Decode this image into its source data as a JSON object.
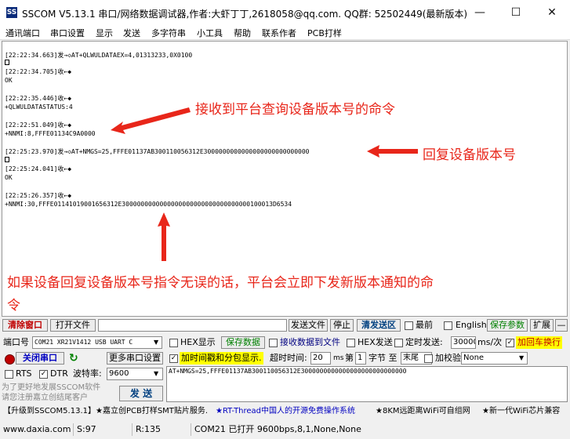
{
  "window": {
    "title": "SSCOM V5.13.1 串口/网络数据调试器,作者:大虾丁丁,2618058@qq.com. QQ群: 52502449(最新版本)",
    "app_icon": "SS",
    "minimize": "—",
    "maximize": "☐",
    "close": "✕"
  },
  "menu": [
    "通讯端口",
    "串口设置",
    "显示",
    "发送",
    "多字符串",
    "小工具",
    "帮助",
    "联系作者",
    "PCB打样"
  ],
  "receive_log": [
    "[22:22:34.663]发→◇AT+QLWULDATAEX=4,01313233,0X0100",
    "[22:22:34.705]收←◆",
    "OK",
    "[22:22:35.446]收←◆",
    "+QLWULDATASTATUS:4",
    "[22:22:51.049]收←◆",
    "+NNMI:8,FFFE01134C9A0000",
    "[22:25:23.970]发→◇AT+NMGS=25,FFFE01137AB300110056312E3000000000000000000000000000",
    "[22:25:24.041]收←◆",
    "OK",
    "[22:25:26.357]收←◆",
    "+NNMI:30,FFFE01141019001656312E3000000000000000000000000000000000100013D6534"
  ],
  "annotations": {
    "a1": "接收到平台查询设备版本号的命令",
    "a2": "回复设备版本号",
    "a3_line1": "如果设备回复设备版本号指令无误的话，平台会立即下发新版本通知的命",
    "a3_line2": "令"
  },
  "toolbar1": {
    "clear_window": "清除窗口",
    "open_file": "打开文件",
    "send_file": "发送文件",
    "stop": "停止",
    "clear_send": "清发送区",
    "topmost": "最前",
    "english": "English",
    "save_params": "保存参数",
    "expand": "扩展",
    "minus": "—"
  },
  "row2": {
    "port_label": "端口号",
    "port_value": "COM21 XR21V1412 USB UART C",
    "hex_display": "HEX显示",
    "save_data": "保存数据",
    "recv_to_file": "接收数据到文件",
    "hex_send": "HEX发送",
    "timed_send": "定时发送:",
    "interval": "30000",
    "interval_unit": "ms/次",
    "add_crlf": "加回车换行"
  },
  "row3": {
    "close_port": "关闭串口",
    "more_settings": "更多串口设置",
    "timestamp": "加时间戳和分包显示.",
    "timeout_label": "超时时间:",
    "timeout": "20",
    "ms": "ms",
    "page_label": "第",
    "page": "1",
    "byte_label": "字节 至",
    "to_value": "末尾",
    "checksum_label": "加校验",
    "checksum_value": "None"
  },
  "row4": {
    "rts": "RTS",
    "dtr": "DTR",
    "baud_label": "波特率:",
    "baud": "9600"
  },
  "send_text": "AT+NMGS=25,FFFE01137AB300110056312E3000000000000000000000000000",
  "send_button": "发 送",
  "register_text_1": "为了更好地发展SSCOM软件",
  "register_text_2": "请您注册嘉立创结尾客户",
  "promo": [
    "【升级到SSCOM5.13.1】★嘉立创PCB打样SMT贴片服务.",
    "★RT-Thread中国人的开源免费操作系统",
    "★8KM远距离WiFi可自组网",
    "★新一代WiFi芯片兼容"
  ],
  "statusbar": {
    "url": "www.daxia.com",
    "sent": "S:97",
    "received": "R:135",
    "port_status": "COM21 已打开  9600bps,8,1,None,None"
  },
  "colors": {
    "annotation": "#e8261a",
    "save_params": "#008000",
    "clear_window": "#c00000",
    "add_crlf_bg": "#ffff00"
  }
}
